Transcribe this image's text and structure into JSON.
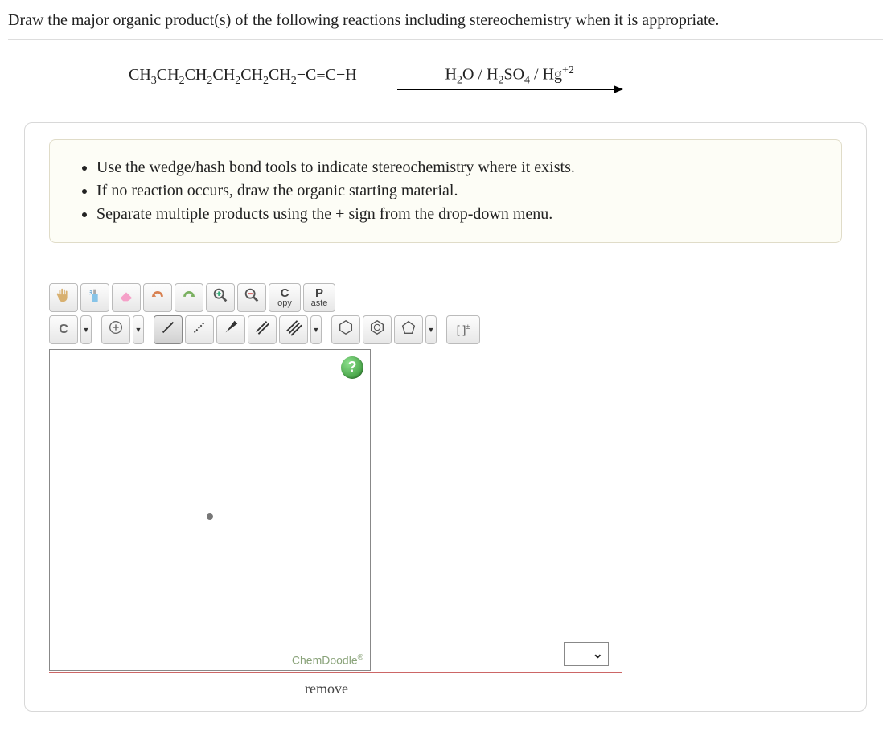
{
  "question": "Draw the major organic product(s) of the following reactions including stereochemistry when it is appropriate.",
  "reaction": {
    "reactant_html": "CH<sub>3</sub>CH<sub>2</sub>CH<sub>2</sub>CH<sub>2</sub>CH<sub>2</sub>CH<sub>2</sub>−C≡C−H",
    "conditions_html": "H<sub>2</sub>O / H<sub>2</sub>SO<sub>4</sub> / Hg<sup>+2</sup>"
  },
  "instructions": [
    "Use the wedge/hash bond tools to indicate stereochemistry where it exists.",
    "If no reaction occurs, draw the organic starting material.",
    "Separate multiple products using the + sign from the drop-down menu."
  ],
  "toolbar_row1": {
    "move": "✋",
    "clear": "🧴",
    "erase": "◧",
    "undo": "↶",
    "redo": "↷",
    "zoom_in": "⊕",
    "zoom_out": "⊖",
    "copy_top": "C",
    "copy_bottom": "opy",
    "paste_top": "P",
    "paste_bottom": "aste"
  },
  "toolbar_row2": {
    "element": "C",
    "charge": "⊕",
    "single_bond": "/",
    "dotted_bond": "⋰",
    "wedge_bond": "◢",
    "double_bond": "⫽",
    "triple_bond": "⫴",
    "hexagon": "⬡",
    "benzene": "⌬",
    "pentagon": "⬠",
    "bracket": "[ ]±"
  },
  "canvas": {
    "help": "?",
    "brand": "ChemDoodle",
    "brand_suffix": "®"
  },
  "plus_menu_caret": "⌄",
  "remove_label": "remove"
}
